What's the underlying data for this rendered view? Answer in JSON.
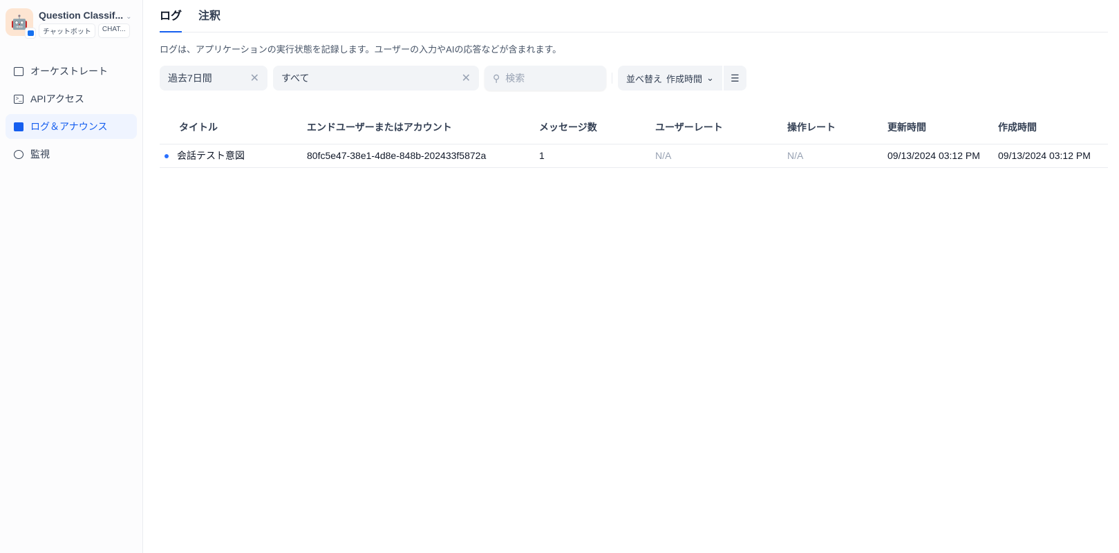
{
  "app": {
    "name": "Question Classif...",
    "tags": [
      "チャットボット",
      "CHAT..."
    ]
  },
  "nav": [
    {
      "label": "オーケストレート"
    },
    {
      "label": "APIアクセス"
    },
    {
      "label": "ログ＆アナウンス"
    },
    {
      "label": "監視"
    }
  ],
  "tabs": [
    "ログ",
    "注釈"
  ],
  "description": "ログは、アプリケーションの実行状態を記録します。ユーザーの入力やAIの応答などが含まれます。",
  "filters": {
    "period": "過去7日間",
    "status": "すべて",
    "search_placeholder": "検索",
    "sort_label": "並べ替え",
    "sort_value": "作成時間"
  },
  "table": {
    "headers": [
      "タイトル",
      "エンドユーザーまたはアカウント",
      "メッセージ数",
      "ユーザーレート",
      "操作レート",
      "更新時間",
      "作成時間"
    ],
    "rows": [
      {
        "title": "会話テスト意図",
        "user": "80fc5e47-38e1-4d8e-848b-202433f5872a",
        "messages": "1",
        "user_rate": "N/A",
        "op_rate": "N/A",
        "updated": "09/13/2024 03:12 PM",
        "created": "09/13/2024 03:12 PM"
      }
    ]
  }
}
